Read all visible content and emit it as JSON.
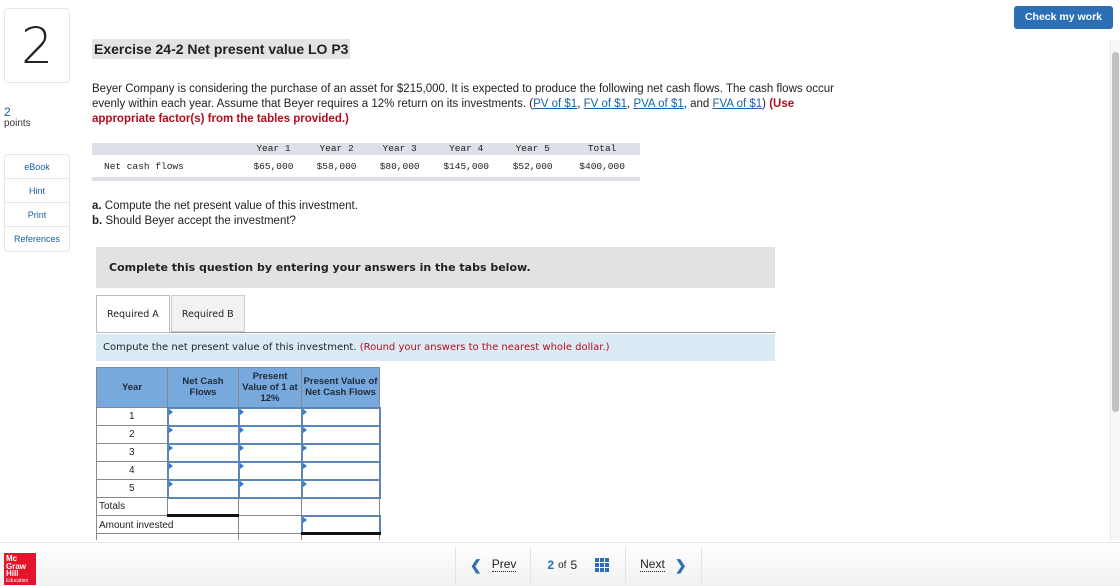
{
  "header": {
    "question_number": "2",
    "points_value": "2",
    "points_label": "points",
    "check_button": "Check my work"
  },
  "tools": [
    {
      "label": "eBook"
    },
    {
      "label": "Hint"
    },
    {
      "label": "Print"
    },
    {
      "label": "References"
    }
  ],
  "exercise": {
    "title": "Exercise 24-2 Net present value LO P3",
    "intro_text": "Beyer Company is considering the purchase of an asset for $215,000. It is expected to produce the following net cash flows. The cash flows occur evenly within each year. Assume that Beyer requires a 12% return on its investments. (",
    "links": [
      "PV of $1",
      "FV of $1",
      "PVA of $1",
      "FVA of $1"
    ],
    "link_sep_1": ", ",
    "link_sep_2": ", ",
    "link_sep_3": ", and ",
    "link_close": ")",
    "instruction": "(Use appropriate factor(s) from the tables provided.)"
  },
  "cash_flow_table": {
    "row_label": "Net cash flows",
    "headers": [
      "Year 1",
      "Year 2",
      "Year 3",
      "Year 4",
      "Year 5",
      "Total"
    ],
    "values": [
      "$65,000",
      "$58,000",
      "$80,000",
      "$145,000",
      "$52,000",
      "$400,000"
    ]
  },
  "questions": {
    "a_label": "a.",
    "a_text": "Compute the net present value of this investment.",
    "b_label": "b.",
    "b_text": "Should Beyer accept the investment?"
  },
  "banner": "Complete this question by entering your answers in the tabs below.",
  "tabs": [
    {
      "label": "Required A",
      "active": true
    },
    {
      "label": "Required B",
      "active": false
    }
  ],
  "tab_instruction": {
    "text": "Compute the net present value of this investment.",
    "note": "(Round your answers to the nearest whole dollar.)"
  },
  "answer_grid": {
    "headers": [
      "Year",
      "Net Cash Flows",
      "Present Value of 1 at 12%",
      "Present Value of Net Cash Flows"
    ],
    "years": [
      "1",
      "2",
      "3",
      "4",
      "5"
    ],
    "totals_label": "Totals",
    "amount_invested_label": "Amount invested",
    "inputs": {
      "net_cash_flows": [
        "",
        "",
        "",
        "",
        ""
      ],
      "pv_factor": [
        "",
        "",
        "",
        "",
        ""
      ],
      "pv_cash_flows": [
        "",
        "",
        "",
        "",
        ""
      ],
      "amount_invested": ""
    }
  },
  "footer": {
    "logo_lines": [
      "Mc",
      "Graw",
      "Hill",
      "Education"
    ],
    "prev": "Prev",
    "current_page": "2",
    "of_label": "of",
    "total_pages": "5",
    "next": "Next"
  }
}
